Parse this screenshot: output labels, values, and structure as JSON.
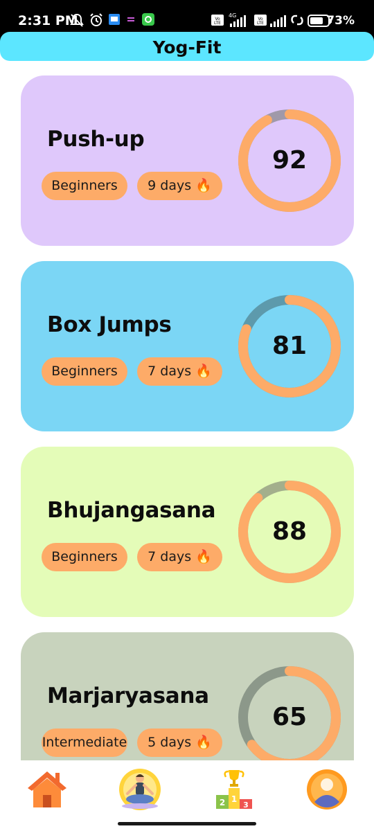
{
  "status_bar": {
    "time": "2:31 PM",
    "network_label_1": "Vo LTE",
    "network_type": "4G",
    "network_label_2": "Vo LTE",
    "battery_percent": "73%"
  },
  "header": {
    "title": "Yog-Fit"
  },
  "exercises": [
    {
      "name": "Push-up",
      "level": "Beginners",
      "streak": "9 days 🔥",
      "score": "92",
      "progress": 0.92,
      "card_color": "#dfc8fb",
      "ring_track_color": "#a099a9",
      "ring_fill_color": "#fdab68"
    },
    {
      "name": "Box Jumps",
      "level": "Beginners",
      "streak": "7 days 🔥",
      "score": "81",
      "progress": 0.81,
      "card_color": "#7bd6f5",
      "ring_track_color": "#5d9aac",
      "ring_fill_color": "#fdab68"
    },
    {
      "name": "Bhujangasana",
      "level": "Beginners",
      "streak": "7 days 🔥",
      "score": "88",
      "progress": 0.88,
      "card_color": "#e4fcb8",
      "ring_track_color": "#a3af8c",
      "ring_fill_color": "#fdab68"
    },
    {
      "name": "Marjaryasana",
      "level": "Intermediate",
      "streak": "5 days 🔥",
      "score": "65",
      "progress": 0.65,
      "card_color": "#c8d3bd",
      "ring_track_color": "#8c988a",
      "ring_fill_color": "#fdab68"
    }
  ],
  "bottom_nav": [
    {
      "icon": "home-icon"
    },
    {
      "icon": "yoga-meditation-icon"
    },
    {
      "icon": "leaderboard-podium-icon"
    },
    {
      "icon": "profile-avatar-icon"
    }
  ],
  "colors": {
    "header_bg": "#5ce6ff",
    "chip_bg": "#fdab68",
    "accent": "#fdab68"
  }
}
